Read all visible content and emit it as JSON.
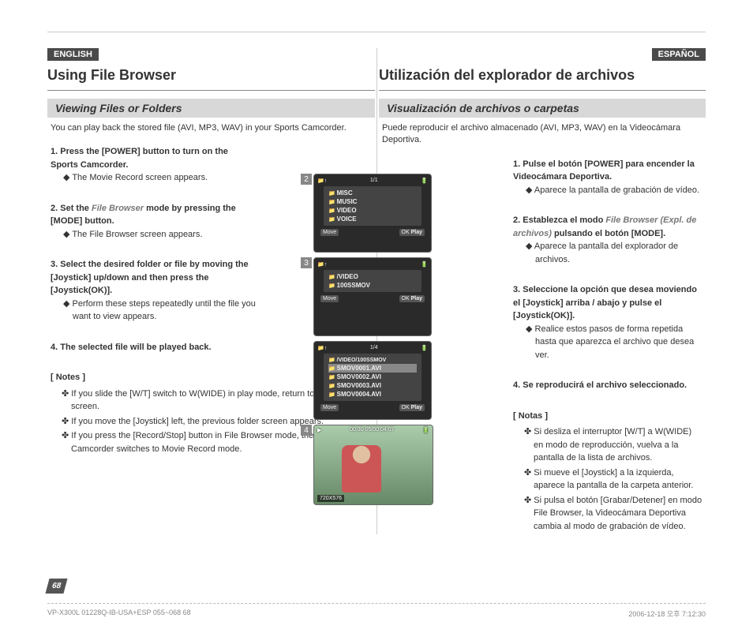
{
  "left": {
    "lang": "ENGLISH",
    "title": "Using File Browser",
    "subheading": "Viewing Files or Folders",
    "intro": "You can play back the stored file (AVI, MP3, WAV) in your Sports Camcorder.",
    "steps": [
      {
        "num": "1.",
        "head": "Press the [POWER] button to turn on the Sports Camcorder.",
        "sub": "The Movie Record screen appears."
      },
      {
        "num": "2.",
        "head_pre": "Set the ",
        "mode": "File Browser",
        "head_post": " mode by pressing the [MODE] button.",
        "sub": "The File Browser screen appears."
      },
      {
        "num": "3.",
        "head": "Select the desired folder or file by moving the [Joystick] up/down and then press the [Joystick(OK)].",
        "sub": "Perform these steps repeatedly until the file you want to view appears."
      },
      {
        "num": "4.",
        "head": "The selected file will be played back.",
        "sub": ""
      }
    ],
    "notes_title": "[ Notes ]",
    "notes": [
      "If you slide the [W/T] switch to W(WIDE) in play mode, return to the file list screen.",
      "If you move the [Joystick] left, the previous folder screen appears.",
      "If you press the [Record/Stop] button in File Browser mode, the Sports Camcorder switches to Movie Record mode."
    ]
  },
  "right": {
    "lang": "ESPAÑOL",
    "title": "Utilización del explorador de archivos",
    "subheading": "Visualización de archivos o carpetas",
    "intro": "Puede reproducir el archivo almacenado (AVI, MP3, WAV) en la Videocámara Deportiva.",
    "steps": [
      {
        "num": "1.",
        "head": "Pulse el botón [POWER] para encender la Videocámara Deportiva.",
        "sub": "Aparece la pantalla de grabación de vídeo."
      },
      {
        "num": "2.",
        "head_pre": "Establezca el modo ",
        "mode": "File Browser (Expl. de archivos)",
        "head_post": " pulsando el botón [MODE].",
        "sub": "Aparece la pantalla del explorador de archivos."
      },
      {
        "num": "3.",
        "head": "Seleccione la opción que desea moviendo el [Joystick] arriba / abajo y pulse el [Joystick(OK)].",
        "sub": "Realice estos pasos de forma repetida hasta que aparezca el archivo que desea ver."
      },
      {
        "num": "4.",
        "head": "Se reproducirá el archivo seleccionado.",
        "sub": ""
      }
    ],
    "notes_title": "[ Notas ]",
    "notes": [
      "Si desliza el interruptor [W/T] a W(WIDE) en modo de reproducción, vuelva a la pantalla de la lista de archivos.",
      "Si mueve el [Joystick] a la izquierda, aparece la pantalla de la carpeta anterior.",
      "Si pulsa el botón [Grabar/Detener] en modo File Browser, la Videocámara Deportiva cambia al modo de grabación de vídeo."
    ]
  },
  "screens": {
    "s2": {
      "num": "2",
      "page": "1/1",
      "folders": [
        "MISC",
        "MUSIC",
        "VIDEO",
        "VOICE"
      ],
      "move": "Move",
      "play": "Play"
    },
    "s3": {
      "num": "3",
      "path": "/VIDEO",
      "folders": [
        "100SSMOV"
      ],
      "move": "Move",
      "play": "Play"
    },
    "s3b": {
      "page": "1/4",
      "path": "/VIDEO/100SSMOV",
      "files": [
        "SMOV0001.AVI",
        "SMOV0002.AVI",
        "SMOV0003.AVI",
        "SMOV0004.AVI"
      ],
      "move": "Move",
      "play": "Play"
    },
    "s4": {
      "num": "4",
      "time": "00:30 05/00:04:07",
      "res": "720X576"
    }
  },
  "page_num": "68",
  "footer": {
    "left": "VP-X300L 01228Q-IB-USA+ESP 055~068   68",
    "right": "2006-12-18   오후 7:12:30"
  }
}
